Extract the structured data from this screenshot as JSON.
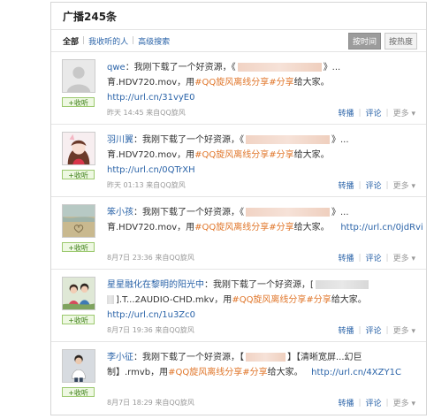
{
  "header": {
    "title": "广播245条"
  },
  "toolbar": {
    "tab_all": "全部",
    "tab_following": "我收听的人",
    "tab_advanced": "高级搜索",
    "sort_time": "按时间",
    "sort_heat": "按热度"
  },
  "labels": {
    "listen": "+收听",
    "forward": "转播",
    "comment": "评论",
    "more": "更多"
  },
  "items": [
    {
      "name": "qwe",
      "l1_pre": "：我刚下载了一个好资源，《",
      "l1_post": "》...",
      "l2_pre": "育.HDV720.mov，用",
      "tag": "#QQ旋风离线分享#分享",
      "l2_post": "给大家。",
      "l3": "http://url.cn/31vyE0",
      "time": "昨天 14:45",
      "source": "来自QQ旋风"
    },
    {
      "name": "羽川翼",
      "l1_pre": "：我刚下载了一个好资源，《",
      "l1_post": "》...",
      "l2_pre": "育.HDV720.mov，用",
      "tag": "#QQ旋风离线分享#分享",
      "l2_post": "给大家。",
      "l3": "http://url.cn/0QTrXH",
      "time": "昨天 01:13",
      "source": "来自QQ旋风"
    },
    {
      "name": "笨小孩",
      "l1_pre": "：我刚下载了一个好资源，《",
      "l1_post": "》...",
      "l2_pre": "育.HDV720.mov，用",
      "tag": "#QQ旋风离线分享#分享",
      "l2_post": "给大家。",
      "l2_url": "http://url.cn/0jdRvi",
      "time": "8月7日 23:36",
      "source": "来自QQ旋风"
    },
    {
      "name": "星星融化在黎明的阳光中",
      "l1_pre": "：我刚下载了一个好资源，[",
      "l2_pre": "].T...2AUDIO-CHD.mkv，用",
      "tag": "#QQ旋风离线分享#分享",
      "l2_post": "给大家。",
      "l3": "http://url.cn/1u3Zc0",
      "time": "8月7日 19:36",
      "source": "来自QQ旋风"
    },
    {
      "name": "李小征",
      "l1_pre": "：我刚下载了一个好资源，【",
      "l1_post": "】【清晰宽屏...幻巨",
      "l2_pre": "制】.rmvb，用",
      "tag": "#QQ旋风离线分享#分享",
      "l2_post": "给大家。",
      "l2_url": "http://url.cn/4XZY1C",
      "time": "8月7日 18:29",
      "source": "来自QQ旋风"
    }
  ]
}
